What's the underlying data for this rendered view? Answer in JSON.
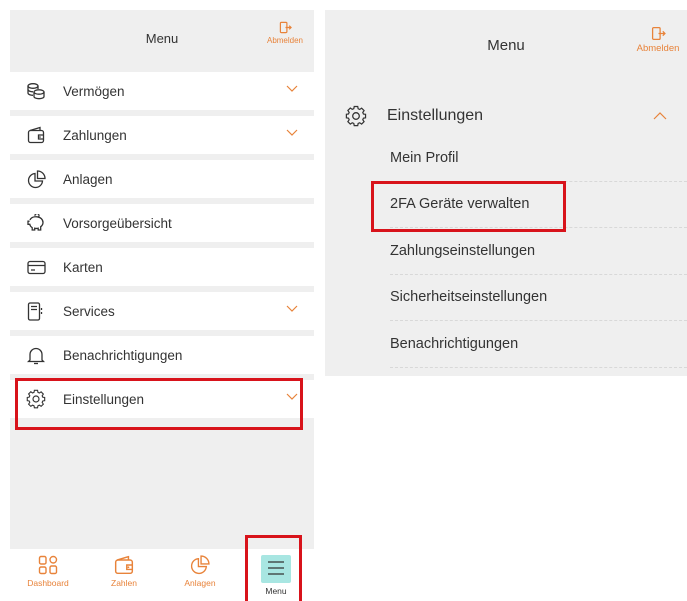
{
  "left": {
    "header": {
      "title": "Menu",
      "logout_label": "Abmelden"
    },
    "items": [
      {
        "label": "Vermögen",
        "icon": "coins-icon",
        "expandable": true
      },
      {
        "label": "Zahlungen",
        "icon": "wallet-icon",
        "expandable": true
      },
      {
        "label": "Anlagen",
        "icon": "pie-chart-icon",
        "expandable": false
      },
      {
        "label": "Vorsorgeübersicht",
        "icon": "piggy-bank-icon",
        "expandable": false
      },
      {
        "label": "Karten",
        "icon": "card-icon",
        "expandable": false
      },
      {
        "label": "Services",
        "icon": "services-icon",
        "expandable": true
      },
      {
        "label": "Benachrichtigungen",
        "icon": "bell-icon",
        "expandable": false
      },
      {
        "label": "Einstellungen",
        "icon": "gear-icon",
        "expandable": true
      }
    ],
    "bottom_nav": [
      {
        "label": "Dashboard",
        "icon": "dashboard-icon"
      },
      {
        "label": "Zahlen",
        "icon": "wallet-icon"
      },
      {
        "label": "Anlagen",
        "icon": "pie-chart-icon"
      },
      {
        "label": "Menu",
        "icon": "hamburger-icon",
        "active": true
      }
    ]
  },
  "right": {
    "header": {
      "title": "Menu",
      "logout_label": "Abmelden"
    },
    "section": {
      "label": "Einstellungen",
      "icon": "gear-icon",
      "expanded": true
    },
    "sub_items": [
      "Mein Profil",
      "2FA Geräte verwalten",
      "Zahlungseinstellungen",
      "Sicherheitseinstellungen",
      "Benachrichtigungen"
    ]
  },
  "colors": {
    "accent": "#e8833a",
    "highlight": "#d8131b",
    "menu_active_bg": "#a8e6e2",
    "panel_bg": "#efefef"
  }
}
